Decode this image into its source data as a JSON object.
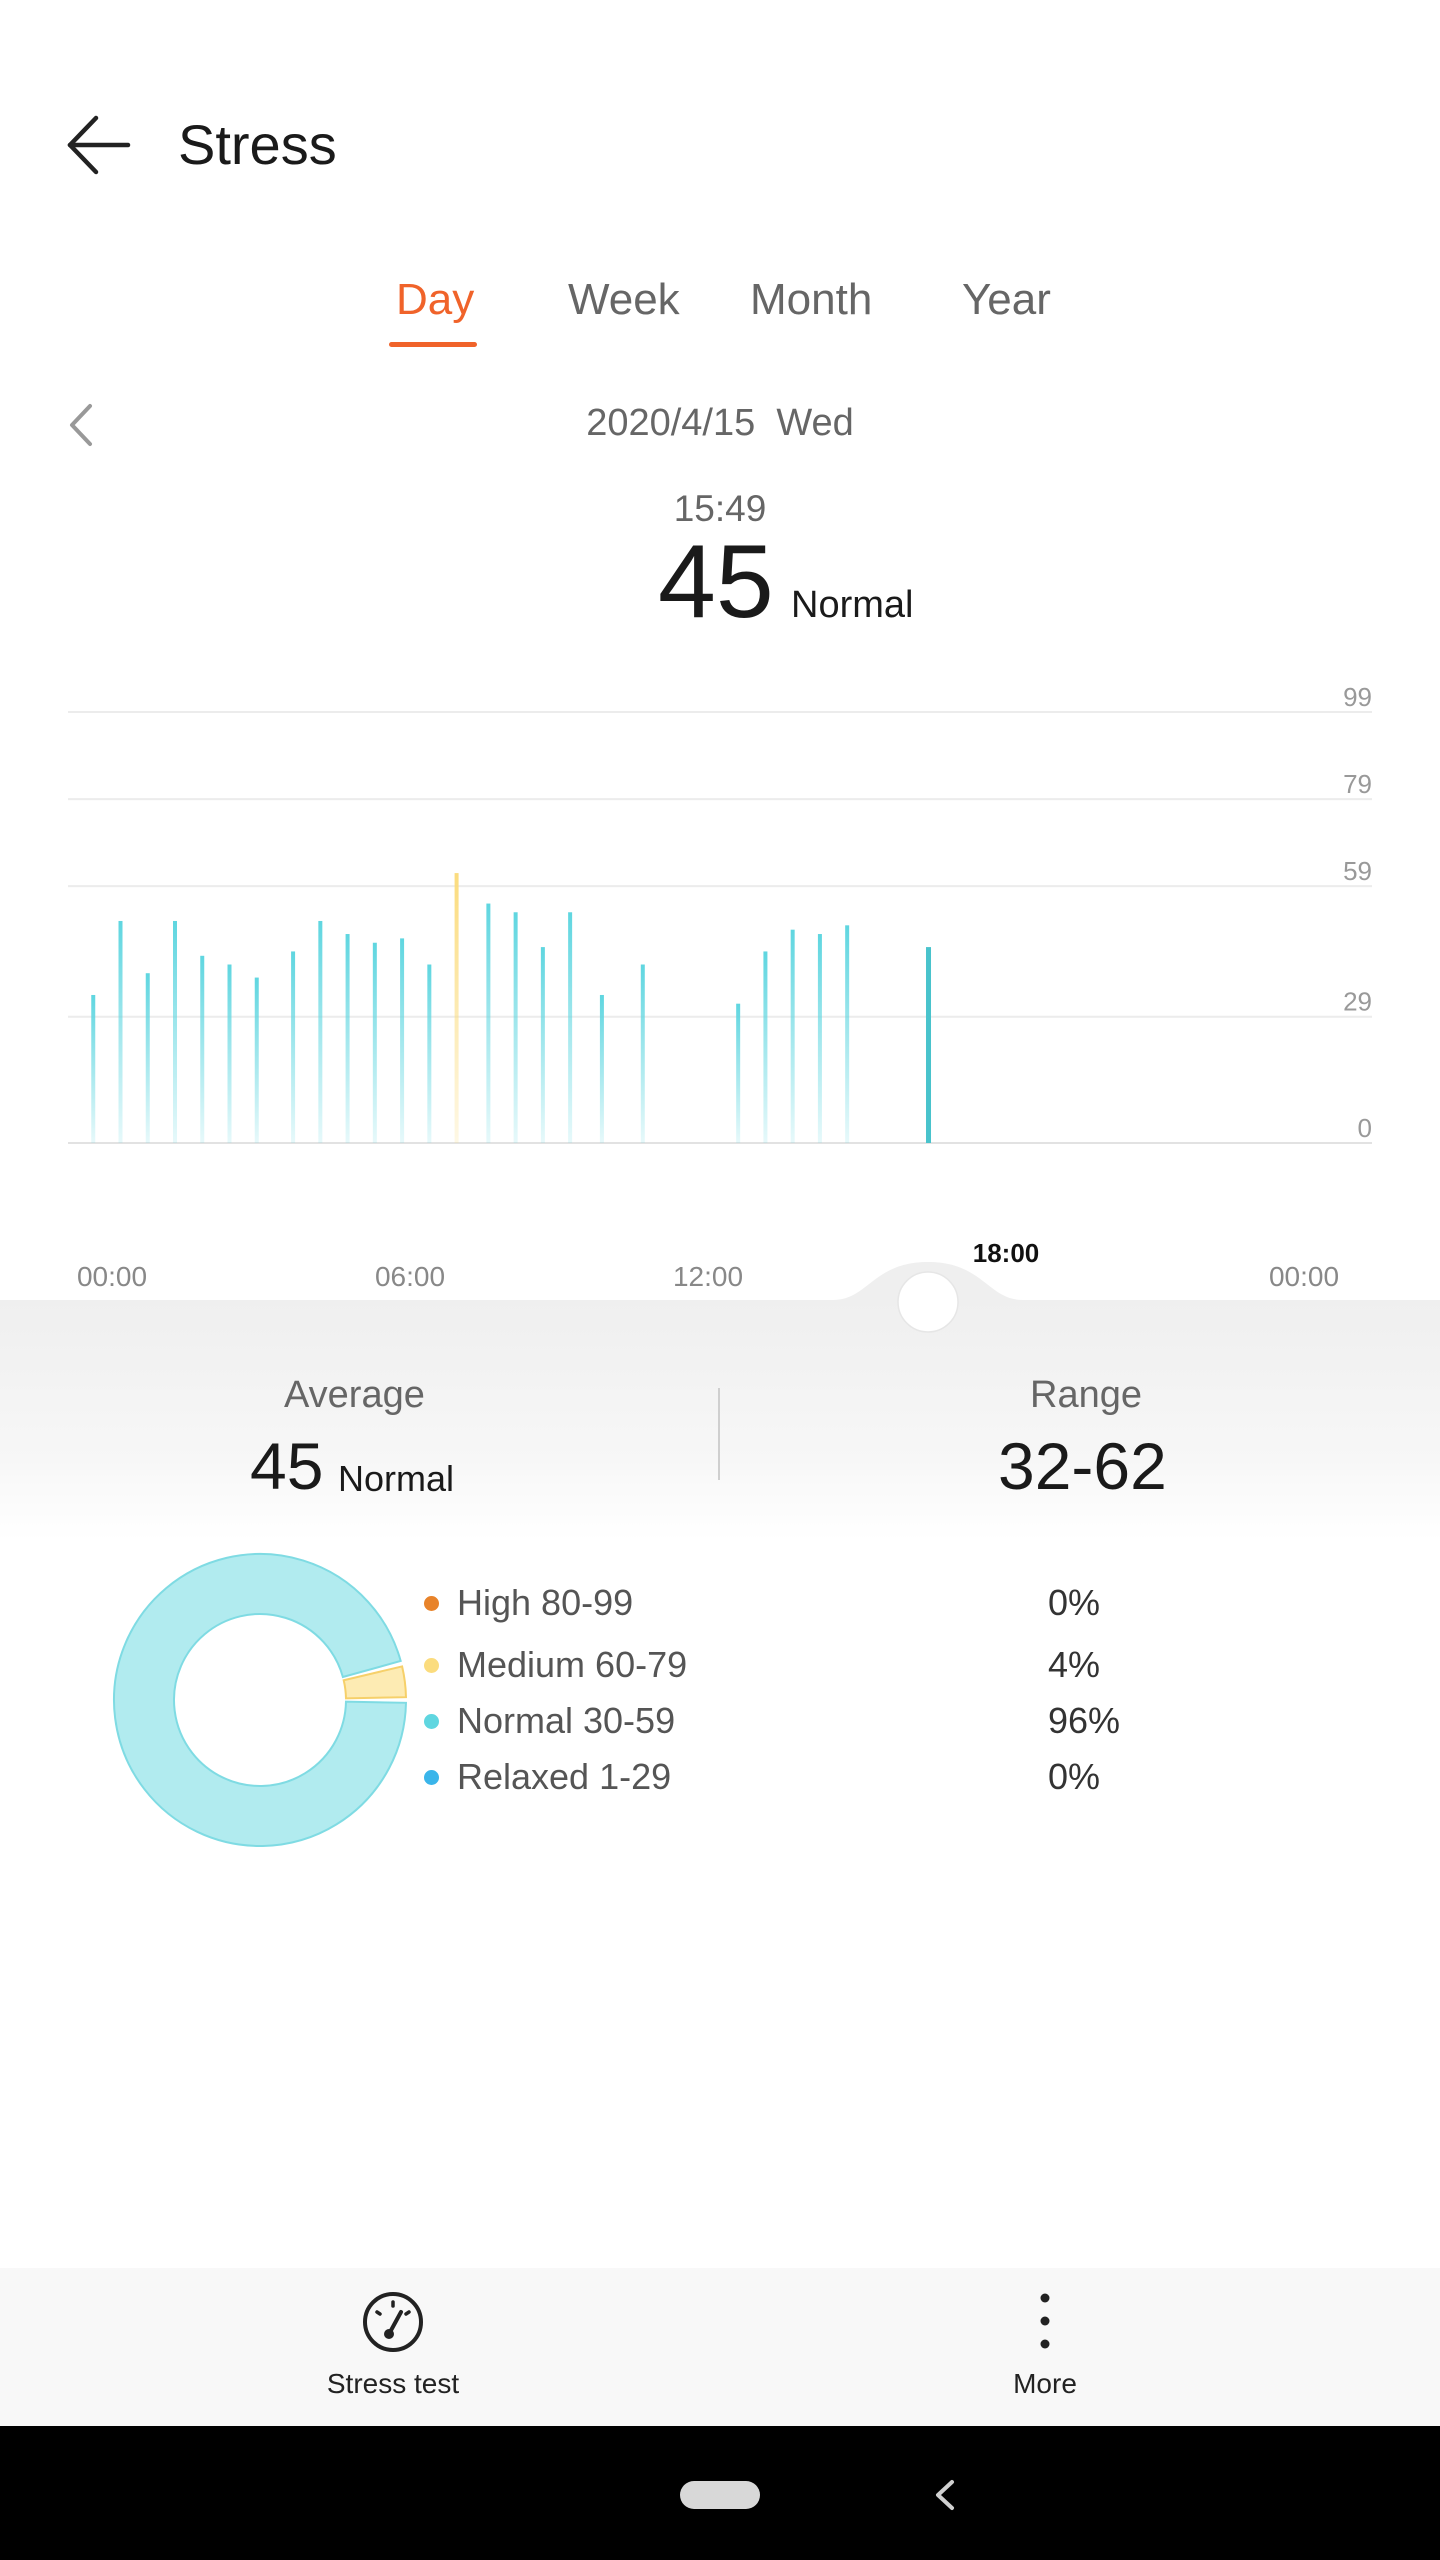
{
  "header": {
    "title": "Stress",
    "back_icon": "arrow-left-icon"
  },
  "tabs": [
    {
      "label": "Day",
      "active": true
    },
    {
      "label": "Week",
      "active": false
    },
    {
      "label": "Month",
      "active": false
    },
    {
      "label": "Year",
      "active": false
    }
  ],
  "date_nav": {
    "prev_icon": "chevron-left-icon",
    "date": "2020/4/15  Wed"
  },
  "selection": {
    "time": "15:49",
    "value": "45",
    "level": "Normal"
  },
  "chart_data": {
    "type": "bar",
    "x_axis": {
      "min": "00:00",
      "max": "24:00",
      "ticks": [
        "00:00",
        "06:00",
        "12:00",
        "18:00",
        "00:00"
      ],
      "active_tick": "18:00"
    },
    "y_axis": {
      "ticks": [
        0,
        29,
        59,
        79,
        99
      ],
      "ylim": [
        0,
        99
      ]
    },
    "grid": true,
    "cursor_time": "15:49",
    "colors": {
      "normal": "#5fd6e0",
      "medium": "#fbdc7e",
      "selected": "#49c3cc"
    },
    "bars": [
      {
        "time": "00:30",
        "value": 34,
        "level": "normal"
      },
      {
        "time": "01:00",
        "value": 51,
        "level": "normal"
      },
      {
        "time": "01:30",
        "value": 39,
        "level": "normal"
      },
      {
        "time": "02:00",
        "value": 51,
        "level": "normal"
      },
      {
        "time": "02:30",
        "value": 43,
        "level": "normal"
      },
      {
        "time": "03:00",
        "value": 41,
        "level": "normal"
      },
      {
        "time": "03:30",
        "value": 38,
        "level": "normal"
      },
      {
        "time": "04:10",
        "value": 44,
        "level": "normal"
      },
      {
        "time": "04:40",
        "value": 51,
        "level": "normal"
      },
      {
        "time": "05:10",
        "value": 48,
        "level": "normal"
      },
      {
        "time": "05:40",
        "value": 46,
        "level": "normal"
      },
      {
        "time": "06:10",
        "value": 47,
        "level": "normal"
      },
      {
        "time": "06:40",
        "value": 41,
        "level": "normal"
      },
      {
        "time": "07:10",
        "value": 62,
        "level": "medium"
      },
      {
        "time": "07:45",
        "value": 55,
        "level": "normal"
      },
      {
        "time": "08:15",
        "value": 53,
        "level": "normal"
      },
      {
        "time": "08:45",
        "value": 45,
        "level": "normal"
      },
      {
        "time": "09:15",
        "value": 53,
        "level": "normal"
      },
      {
        "time": "09:50",
        "value": 34,
        "level": "normal"
      },
      {
        "time": "10:35",
        "value": 41,
        "level": "normal"
      },
      {
        "time": "12:20",
        "value": 32,
        "level": "normal"
      },
      {
        "time": "12:50",
        "value": 44,
        "level": "normal"
      },
      {
        "time": "13:20",
        "value": 49,
        "level": "normal"
      },
      {
        "time": "13:50",
        "value": 48,
        "level": "normal"
      },
      {
        "time": "14:20",
        "value": 50,
        "level": "normal"
      },
      {
        "time": "15:49",
        "value": 45,
        "level": "selected"
      }
    ]
  },
  "summary": {
    "average_label": "Average",
    "average_value": "45",
    "average_level": "Normal",
    "range_label": "Range",
    "range_value": "32-62"
  },
  "distribution": [
    {
      "label": "High 80-99",
      "percent": "0%",
      "color": "#e8832a"
    },
    {
      "label": "Medium 60-79",
      "percent": "4%",
      "color": "#fbdc7e"
    },
    {
      "label": "Normal 30-59",
      "percent": "96%",
      "color": "#5fd6e0"
    },
    {
      "label": "Relaxed 1-29",
      "percent": "0%",
      "color": "#3ab5ea"
    }
  ],
  "donut_data": {
    "medium": 4,
    "normal": 96
  },
  "actions": {
    "stress_test_label": "Stress test",
    "stress_test_icon": "gauge-icon",
    "more_label": "More",
    "more_icon": "more-vertical-icon"
  },
  "system_nav": {
    "home": "home-pill",
    "back": "back-chevron-icon"
  }
}
